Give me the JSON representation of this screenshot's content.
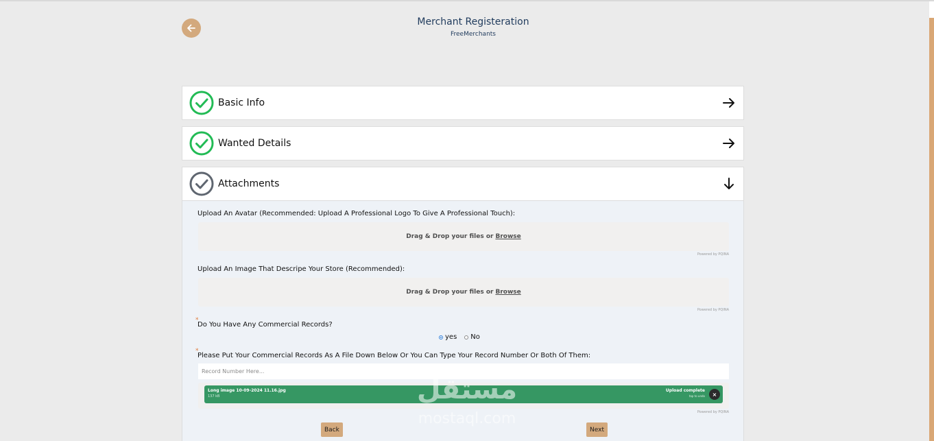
{
  "header": {
    "title": "Merchant Registeration",
    "subtitle": "FreeMerchants"
  },
  "steps": [
    {
      "label": "Basic Info",
      "status": "complete"
    },
    {
      "label": "Wanted Details",
      "status": "complete"
    },
    {
      "label": "Attachments",
      "status": "active"
    }
  ],
  "attachments": {
    "avatar_label": "Upload An Avatar (Recommended: Upload A Professional Logo To Give A Professional Touch):",
    "store_label": "Upload An Image That Descripe Your Store (Recommended):",
    "drop_text": "Drag & Drop your files or",
    "browse_text": "Browse",
    "powered_by": "Powered by PQINA",
    "required_mark": "*",
    "commercial_question": "Do You Have Any Commercial Records?",
    "radio_yes": "yes",
    "radio_no": "No",
    "records_label": "Please Put Your Commercial Records As A File Down Below Or You Can Type Your Record Number Or Both Of Them:",
    "record_placeholder": "Record Number Here...",
    "file": {
      "name": "Long image 10-09-2024 11.16.jpg",
      "size": "137 kB",
      "status": "Upload complete",
      "undo": "tap to undo",
      "remove": "×"
    }
  },
  "buttons": {
    "back": "Back",
    "next": "Next"
  },
  "watermark": {
    "arabic": "مستقل",
    "latin": "mostaql.com"
  },
  "colors": {
    "accent": "#d3a97d",
    "complete": "#22bb55",
    "pending": "#5f6670",
    "upload_ok": "#369763",
    "title": "#1f3a5c"
  }
}
